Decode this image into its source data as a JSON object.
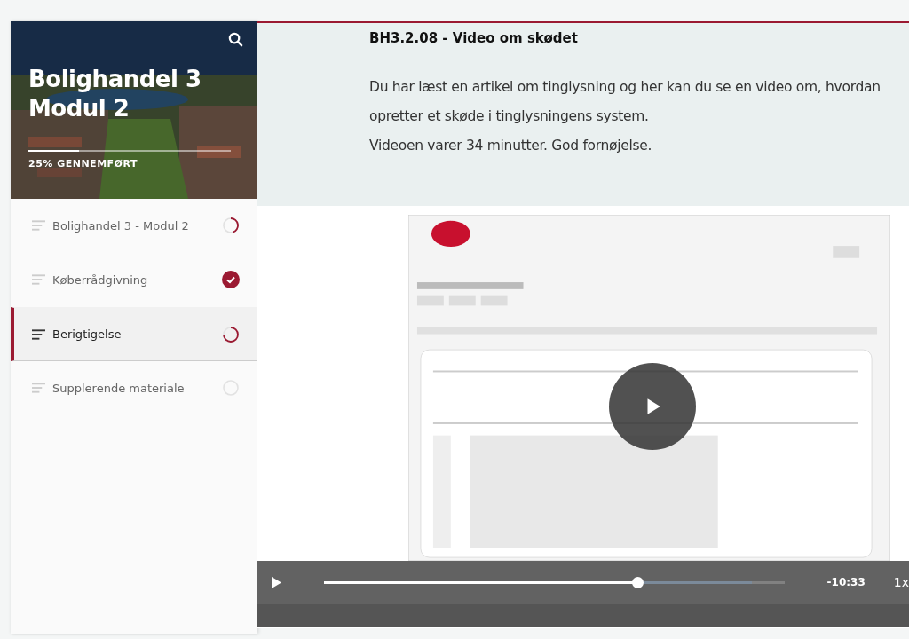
{
  "course": {
    "title_lines": [
      "Bolighandel 3",
      "Modul 2"
    ],
    "progress_label": "25% GENNEMFØRT",
    "level": 0.25
  },
  "sidebar": {
    "items": [
      {
        "label": "Bolighandel 3 - Modul 2",
        "selected": false,
        "completed": false,
        "level": 0.45
      },
      {
        "label": "Køberrådgivning",
        "selected": false,
        "completed": true
      },
      {
        "label": "Berigtigelse",
        "selected": true,
        "completed": false,
        "level": 0.75
      },
      {
        "label": "Supplerende materiale",
        "selected": false,
        "completed": false
      }
    ]
  },
  "lesson": {
    "title": "BH3.2.08 - Video om skødet",
    "lines": [
      "Du har læst en artikel om tinglysning og her kan du se en video om, hvordan",
      "opretter et skøde i tinglysningens system.",
      "Videoen varer 34 minutter. God fornøjelse."
    ]
  },
  "video": {
    "kind": "picture",
    "level": 0.68,
    "time": "-10:33",
    "speed": "1x"
  }
}
